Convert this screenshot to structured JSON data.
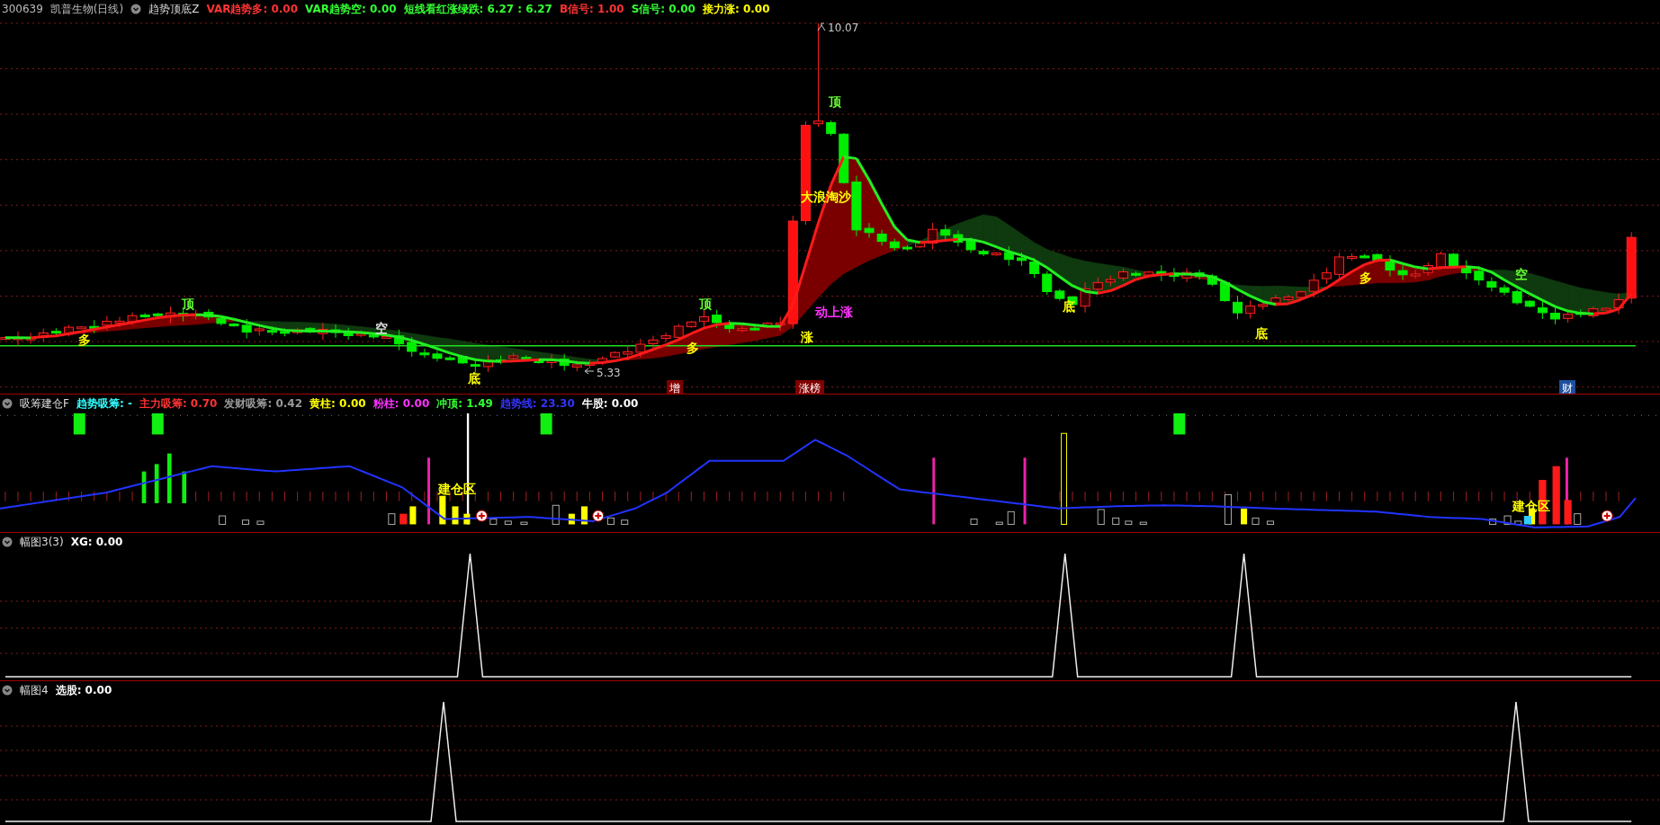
{
  "main_panel": {
    "symbol": "300639",
    "stock_name": "凯普生物(日线)",
    "indicator": "趋势顶底Z",
    "values": [
      {
        "text": "VAR趋势多: 0.00",
        "color": "#ff3333"
      },
      {
        "text": "VAR趋势空: 0.00",
        "color": "#33ff33"
      },
      {
        "text": "短线看红涨绿跌: 6.27 : 6.27",
        "color": "#33ff33"
      },
      {
        "text": "B信号: 1.00",
        "color": "#ff3333"
      },
      {
        "text": "S信号: 0.00",
        "color": "#33ff33"
      },
      {
        "text": "接力涨: 0.00",
        "color": "#ffff00"
      }
    ],
    "price_labels": [
      "10.07",
      "5.33"
    ],
    "annotations": [
      {
        "text": "顶",
        "color": "#66ff33"
      },
      {
        "text": "大浪淘沙",
        "color": "#ffff00"
      },
      {
        "text": "空",
        "color": "#66ff33"
      },
      {
        "text": "多",
        "color": "#ffff00"
      },
      {
        "text": "顶",
        "color": "#66ff33"
      },
      {
        "text": "顶",
        "color": "#66ff33"
      },
      {
        "text": "底",
        "color": "#ffff00"
      },
      {
        "text": "动上涨",
        "color": "#ff33ff"
      },
      {
        "text": "涨",
        "color": "#ffff00"
      },
      {
        "text": "底",
        "color": "#ffff00"
      },
      {
        "text": "空",
        "color": "#dddddd"
      },
      {
        "text": "多",
        "color": "#ffff00"
      },
      {
        "text": "多",
        "color": "#ffff00"
      },
      {
        "text": "底",
        "color": "#ffff00"
      }
    ],
    "tags": [
      {
        "text": "增",
        "color": "#800000"
      },
      {
        "text": "涨榜",
        "color": "#800000"
      },
      {
        "text": "财",
        "color": "#1f4f9f"
      }
    ]
  },
  "panel_2": {
    "indicator": "吸筹建仓F",
    "values": [
      {
        "text": "趋势吸筹: -",
        "color": "#33ffff"
      },
      {
        "text": "主力吸筹: 0.70",
        "color": "#ff3333"
      },
      {
        "text": "发财吸筹: 0.42",
        "color": "#999999"
      },
      {
        "text": "黄柱: 0.00",
        "color": "#ffff00"
      },
      {
        "text": "粉柱: 0.00",
        "color": "#ff33ff"
      },
      {
        "text": "冲顶: 1.49",
        "color": "#33ff33"
      },
      {
        "text": "趋势线: 23.30",
        "color": "#3333ff"
      },
      {
        "text": "牛股: 0.00",
        "color": "#ffffff"
      }
    ],
    "annotations": [
      {
        "text": "建仓区",
        "color": "#ffff00"
      },
      {
        "text": "建仓区",
        "color": "#ffff00"
      }
    ]
  },
  "panel_3": {
    "indicator": "幅图3(3)",
    "values": [
      {
        "text": "XG: 0.00",
        "color": "#ffffff"
      }
    ]
  },
  "panel_4": {
    "indicator": "幅图4",
    "values": [
      {
        "text": "选股: 0.00",
        "color": "#ffffff"
      }
    ]
  }
}
